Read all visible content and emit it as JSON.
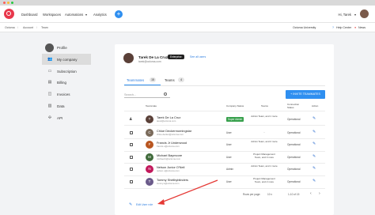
{
  "window": {
    "controls": [
      "#ff5f57",
      "#febc2e",
      "#28c840"
    ]
  },
  "nav": {
    "items": [
      "Dashboard",
      "Workspaces",
      "Automations",
      "Analytics"
    ],
    "automations_caret": "▾",
    "plus": "+",
    "greeting": "Hi, Tarek",
    "greeting_caret": "▾"
  },
  "breadcrumb": {
    "items": [
      "Octoma",
      "Account",
      "Team"
    ],
    "separator": "/"
  },
  "topbar_right": {
    "university": "Octoma University",
    "help": "Help Center",
    "news": "News"
  },
  "sidebar": {
    "items": [
      {
        "label": "Profile",
        "icon": "person-icon",
        "glyph": ""
      },
      {
        "label": "My company",
        "icon": "group-icon",
        "glyph": "👥",
        "active": true
      },
      {
        "label": "Subscription",
        "icon": "card-icon",
        "glyph": "▭"
      },
      {
        "label": "Billing",
        "icon": "billing-icon",
        "glyph": "▤"
      },
      {
        "label": "Invoices",
        "icon": "invoice-icon",
        "glyph": "◫"
      },
      {
        "label": "Data",
        "icon": "data-icon",
        "glyph": "▥"
      },
      {
        "label": "API",
        "icon": "api-icon",
        "glyph": "✣"
      }
    ]
  },
  "user": {
    "name": "Tarek De La Cruz",
    "plan": "Enterprise",
    "link": "See all users",
    "email": "tarek@octoma.com"
  },
  "tabs": [
    {
      "label": "Teammates",
      "count": "15",
      "active": true
    },
    {
      "label": "Teams",
      "count": "4"
    }
  ],
  "search": {
    "placeholder": "Search..."
  },
  "invite_button": "INVITE TEAMMATES",
  "table": {
    "headers": {
      "teammate": "Teammate",
      "company_status": "Company Status",
      "teams": "Teams",
      "connection": "Connection Status",
      "action": "Action"
    },
    "rows": [
      {
        "initial": "T",
        "color": "#5a4038",
        "name": "Tarek De La Cruz",
        "email": "tarek@octoma.com",
        "role": "Super Admin",
        "role_badge": true,
        "teams": "Admin Team, and 1 more",
        "status": "Operational",
        "owner": true
      },
      {
        "initial": "C",
        "color": "#7a6a5a",
        "name": "Chloe Deckermorningstar",
        "email": "chloe.decker@octoma.com",
        "role": "User",
        "teams": "-",
        "status": "Operational"
      },
      {
        "initial": "F",
        "color": "#b8551f",
        "name": "Francis Jr Underwood",
        "email": "francis.u@octoma.com",
        "role": "User",
        "teams": "Admin Team, and 2 more",
        "status": "Operational"
      },
      {
        "initial": "M",
        "color": "#3f6a3a",
        "name": "Michael Baymoore",
        "email": "michael.b@octoma.com",
        "role": "User",
        "teams": "Project Management Team, and 3 more",
        "status": "Operational"
      },
      {
        "initial": "N",
        "color": "#c2185b",
        "name": "Nelson Junior O'Neil",
        "email": "nelson.o@octoma.com",
        "role": "Admin",
        "teams": "Admin Team, and 1 more",
        "status": "Operational"
      },
      {
        "initial": "T",
        "color": "#6a5a8a",
        "name": "Tommy Shellbyblinders",
        "email": "tommy.s@octoma.com",
        "role": "User",
        "teams": "Project Management Team, and 2 more",
        "status": "Operational"
      }
    ]
  },
  "pagination": {
    "rows_label": "Rows per page:",
    "rows_value": "10 ▾",
    "range": "1-10 of 15",
    "prev": "‹",
    "next": "›"
  },
  "edit_roles": "Edit User role",
  "edit_glyph": "✎",
  "owner_glyph": "♟",
  "annotation_arrow_color": "#e53935"
}
